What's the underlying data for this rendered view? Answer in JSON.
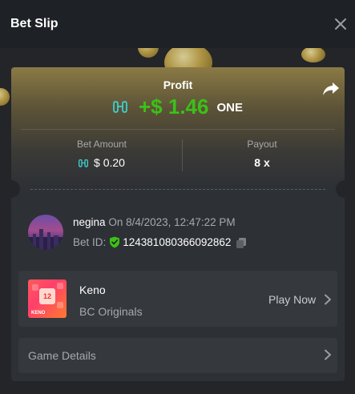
{
  "header": {
    "title": "Bet Slip"
  },
  "profit": {
    "label": "Profit",
    "value": "+$ 1.46",
    "currency": "ONE"
  },
  "bet_amount": {
    "label": "Bet Amount",
    "value": "$ 0.20"
  },
  "payout": {
    "label": "Payout",
    "value": "8 x"
  },
  "user": {
    "name": "negina",
    "on_text": "On 8/4/2023, 12:47:22 PM"
  },
  "bet_id": {
    "label": "Bet ID:",
    "value": "124381080366092862"
  },
  "game": {
    "name": "Keno",
    "provider": "BC Originals",
    "play_label": "Play Now",
    "thumb_number": "12",
    "thumb_label": "KENO"
  },
  "details": {
    "label": "Game Details"
  },
  "colors": {
    "profit_green": "#3bc117",
    "currency_icon": "#3ecfcf",
    "verified_green": "#3bc117"
  }
}
